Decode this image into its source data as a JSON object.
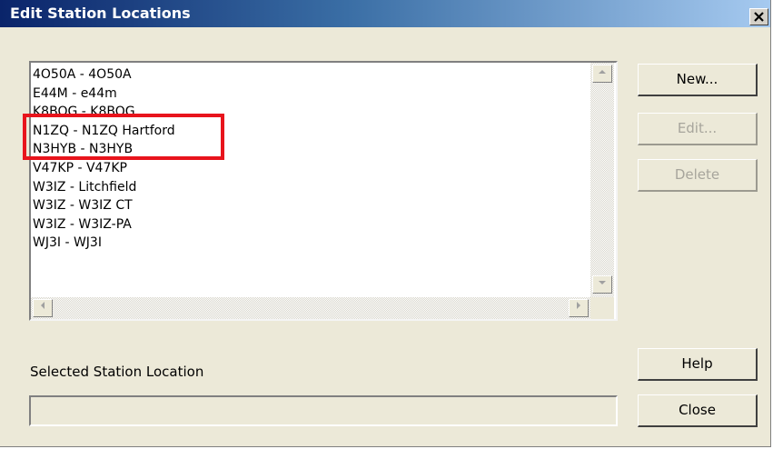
{
  "window": {
    "title": "Edit Station Locations",
    "close_glyph": "✕"
  },
  "locations": [
    "4O50A - 4O50A",
    "E44M - e44m",
    "K8BOG - K8BOG",
    "N1ZQ - N1ZQ Hartford",
    "N3HYB - N3HYB",
    "V47KP - V47KP",
    "W3IZ - Litchfield",
    "W3IZ - W3IZ CT",
    "W3IZ - W3IZ-PA",
    "WJ3I - WJ3I"
  ],
  "buttons": {
    "new": "New...",
    "edit": "Edit...",
    "delete": "Delete",
    "help": "Help",
    "close": "Close"
  },
  "selected": {
    "label": "Selected Station Location",
    "value": ""
  },
  "annotation": {
    "color": "#e8141c",
    "target": "N1ZQ - N1ZQ Hartford"
  }
}
